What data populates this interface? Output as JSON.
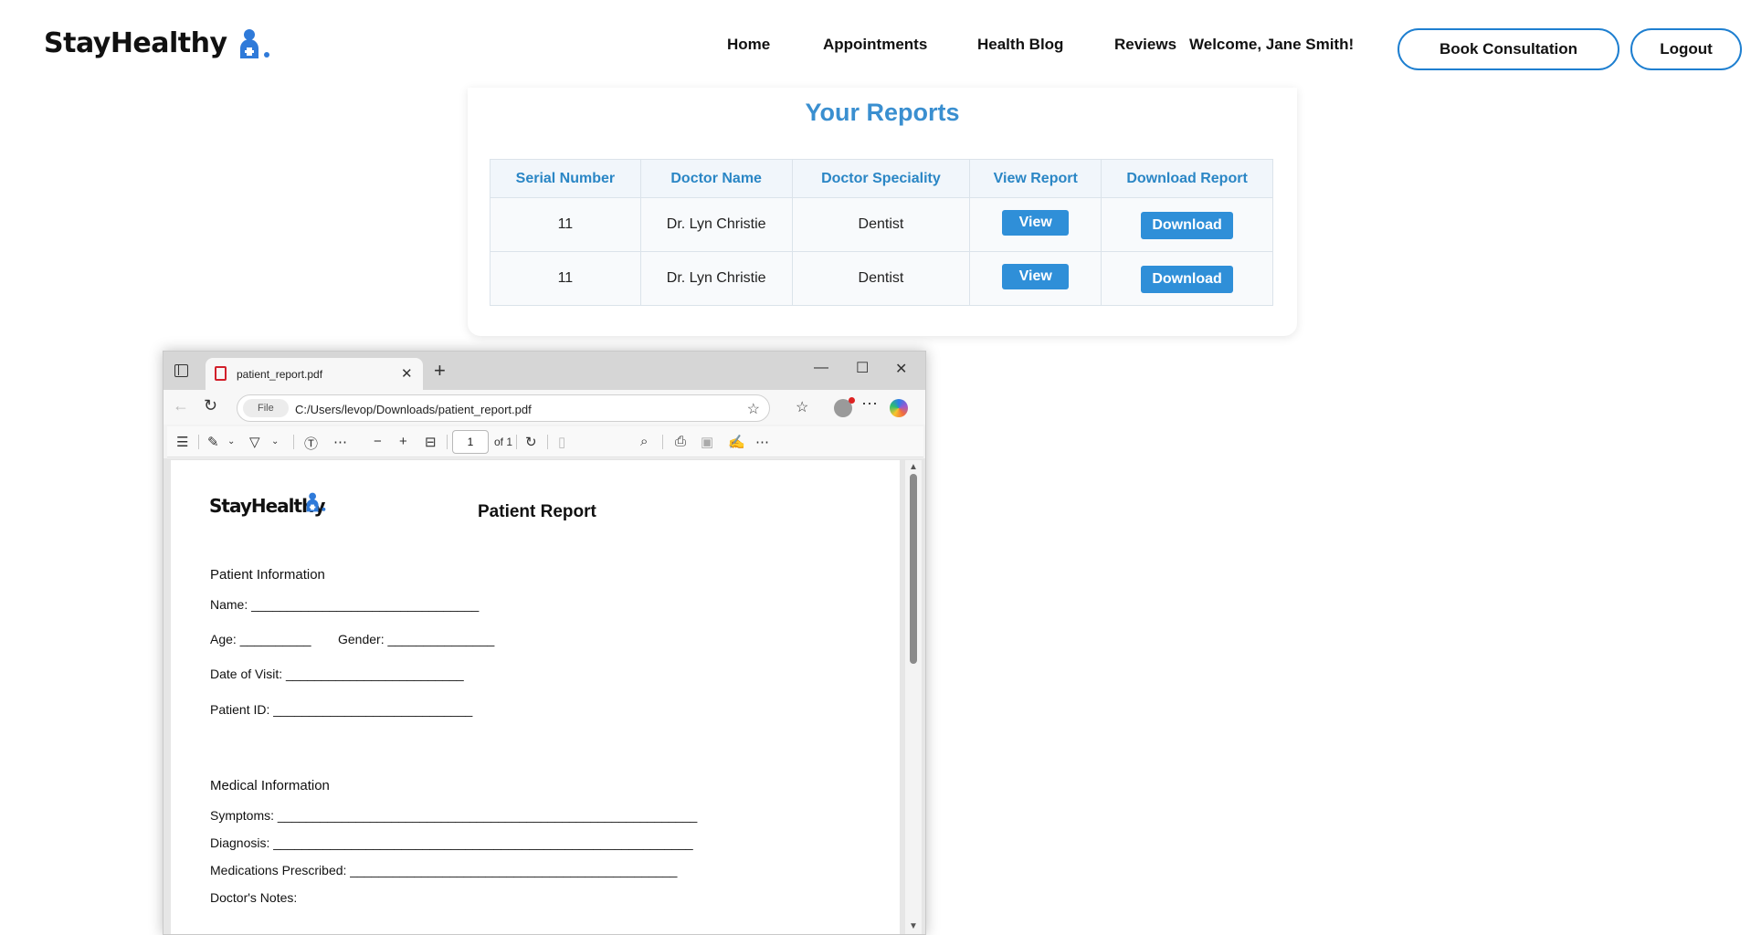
{
  "navbar": {
    "brand": "StayHealthy",
    "links": [
      "Home",
      "Appointments",
      "Health Blog",
      "Reviews"
    ],
    "welcome": "Welcome, Jane Smith!",
    "book_label": "Book Consultation",
    "logout_label": "Logout"
  },
  "reports": {
    "title": "Your Reports",
    "columns": [
      "Serial Number",
      "Doctor Name",
      "Doctor Speciality",
      "View Report",
      "Download Report"
    ],
    "rows": [
      {
        "serial": "11",
        "doctor": "Dr. Lyn Christie",
        "speciality": "Dentist",
        "view": "View",
        "download": "Download"
      },
      {
        "serial": "11",
        "doctor": "Dr. Lyn Christie",
        "speciality": "Dentist",
        "view": "View",
        "download": "Download"
      }
    ]
  },
  "pdf_window": {
    "tab_title": "patient_report.pdf",
    "url_scheme": "File",
    "url": "C:/Users/levop/Downloads/patient_report.pdf",
    "page_number": "1",
    "page_total": "of 1",
    "icons": [
      "sidebar-toggle-icon",
      "pdf-file-icon",
      "close-icon",
      "plus-icon",
      "minimize-icon",
      "maximize-icon",
      "back-icon",
      "refresh-icon",
      "info-icon",
      "star-icon",
      "favorites-icon",
      "profile-icon",
      "more-icon",
      "copilot-icon",
      "contents-icon",
      "highlight-icon",
      "draw-icon",
      "text-icon",
      "zoom-out-icon",
      "zoom-in-icon",
      "fit-page-icon",
      "rotate-icon",
      "page-view-icon",
      "search-icon",
      "print-icon",
      "save-icon",
      "save-as-icon"
    ]
  },
  "pdf_document": {
    "brand": "StayHealthy",
    "title": "Patient Report",
    "patient_section": "Patient Information",
    "name_line": "Name: ________________________________",
    "age_line": "Age: __________",
    "gender_line": "Gender: _______________",
    "visit_line": "Date of Visit: _________________________",
    "id_line": "Patient ID: ____________________________",
    "medical_section": "Medical Information",
    "symptoms_line": "Symptoms: ___________________________________________________________",
    "diagnosis_line": "Diagnosis: ___________________________________________________________",
    "medications_line": "Medications Prescribed: ______________________________________________",
    "notes_line": "Doctor's Notes:"
  }
}
